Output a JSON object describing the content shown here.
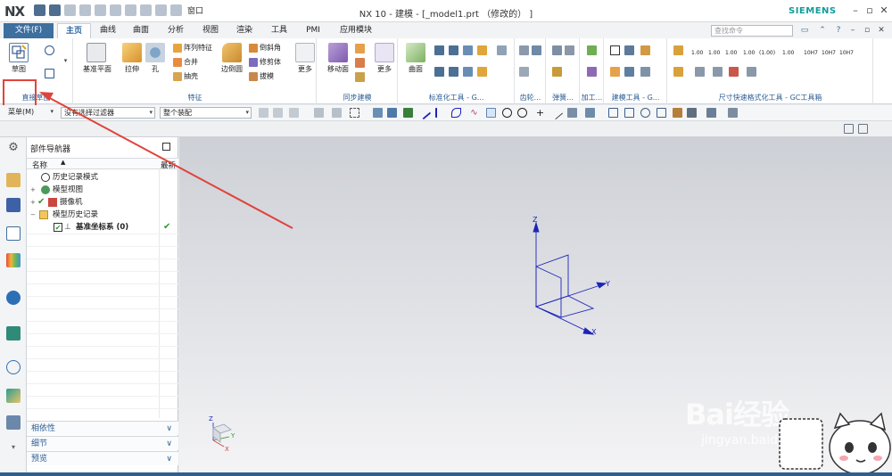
{
  "app": {
    "logo": "NX",
    "window_title": "NX 10 - 建模 - [_model1.prt （修改的） ]",
    "brand": "SIEMENS",
    "window_menu_label": "窗口"
  },
  "tabs": {
    "file": "文件(F)",
    "items": [
      "主页",
      "曲线",
      "曲面",
      "分析",
      "视图",
      "渲染",
      "工具",
      "PMI",
      "应用模块"
    ]
  },
  "search": {
    "placeholder": "查找命令"
  },
  "ribbon": {
    "sketch": "草图",
    "direct_sketch_group": "直接草图",
    "datum_plane": "基准平面",
    "extrude": "拉伸",
    "hole": "孔",
    "pattern_feature": "阵列特征",
    "unite": "合并",
    "shell": "抽壳",
    "edge_blend": "边倒圆",
    "chamfer": "倒斜角",
    "trim_body": "修剪体",
    "draft": "拔模",
    "more": "更多",
    "feature_group": "特征",
    "move_face": "移动面",
    "more2": "更多",
    "sync_group": "同步建模",
    "surface": "曲面",
    "std_tools_group": "标准化工具 - G...",
    "gear_group": "齿轮...",
    "spring_group": "弹簧...",
    "process_group": "加工...",
    "modeling_tools_group": "建模工具 - G...",
    "dim_group": "尺寸快速格式化工具 - GC工具箱",
    "dim_values": [
      "1.00",
      "1.00",
      "1.00",
      "1.00",
      "(1.00)",
      "1.00",
      "10H7",
      "10H7",
      "10H7"
    ]
  },
  "toolbar2": {
    "menu": "菜单(M)",
    "filter": "没有选择过滤器",
    "assembly": "整个装配"
  },
  "navigator": {
    "title": "部件导航器",
    "col_name": "名称",
    "col_latest": "最新",
    "rows": [
      {
        "label": "历史记录模式"
      },
      {
        "label": "模型视图"
      },
      {
        "label": "摄像机"
      },
      {
        "label": "模型历史记录"
      },
      {
        "label": "基准坐标系 (0)"
      }
    ],
    "accordions": [
      "相依性",
      "细节",
      "预览"
    ]
  },
  "viewport": {
    "axis_z": "Z",
    "axis_y": "Y",
    "axis_x": "X",
    "mini_z": "Z",
    "mini_x": "X",
    "mini_y": "Y"
  },
  "watermark": {
    "brand": "Bai经验",
    "url": "jingyan.baidu.com"
  },
  "colors": {
    "accent": "#3d6f9f",
    "highlight": "#e0433b",
    "axis": "#1d25b8",
    "siemens": "#139b9c"
  }
}
